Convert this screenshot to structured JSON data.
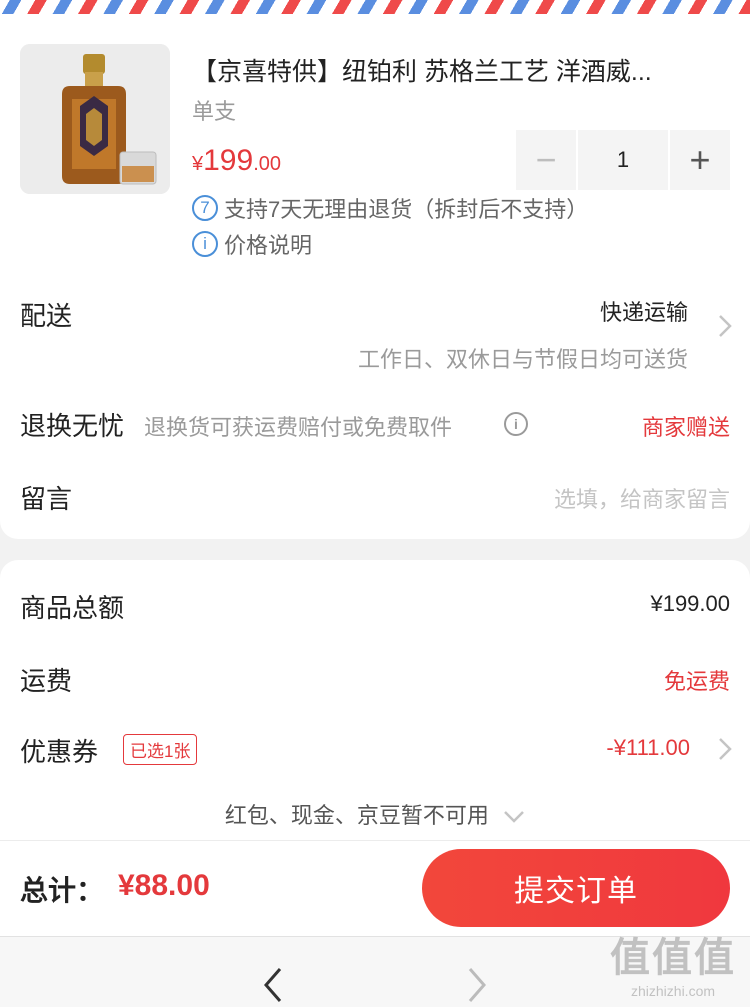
{
  "product": {
    "title": "【京喜特供】纽铂利 苏格兰工艺 洋酒威...",
    "spec": "单支",
    "price_currency": "¥",
    "price_int": "199",
    "price_dec": ".00",
    "quantity": "1",
    "minus_label": "−",
    "plus_label": "+",
    "return_icon": "7",
    "return_policy": "支持7天无理由退货（拆封后不支持）",
    "price_note_icon": "i",
    "price_note": "价格说明"
  },
  "delivery": {
    "label": "配送",
    "method": "快递运输",
    "note": "工作日、双休日与节假日均可送货"
  },
  "return_worry": {
    "label": "退换无忧",
    "desc": "退换货可获运费赔付或免费取件",
    "info_icon": "i",
    "value": "商家赠送"
  },
  "message": {
    "label": "留言",
    "placeholder": "选填，给商家留言"
  },
  "summary": {
    "goods_total_label": "商品总额",
    "goods_total_value": "¥199.00",
    "shipping_label": "运费",
    "shipping_value": "免运费",
    "coupon_label": "优惠券",
    "coupon_badge": "已选1张",
    "coupon_value": "-¥111.00",
    "unavailable": "红包、现金、京豆暂不可用"
  },
  "footer": {
    "total_label": "总计：",
    "total_value": "¥88.00",
    "submit_label": "提交订单"
  },
  "nav": {
    "back_icon": "‹",
    "forward_icon": "›"
  },
  "watermark": {
    "big": "值值值",
    "small": "zhizhizhi.com"
  },
  "colors": {
    "accent": "#e4393c",
    "info": "#4a8fd8"
  }
}
